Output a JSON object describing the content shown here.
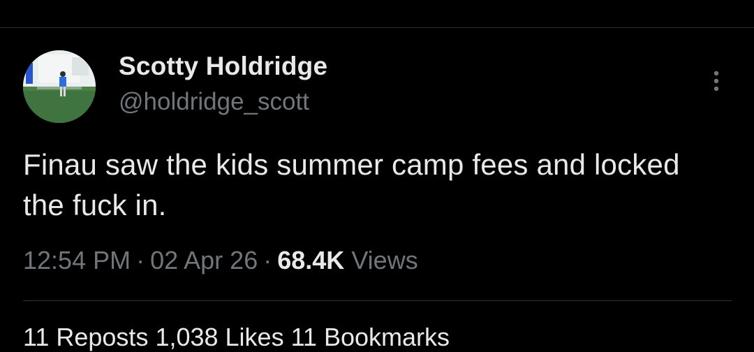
{
  "colors": {
    "background": "#000000",
    "primary_text": "#e7e9ea",
    "secondary_text": "#71767b",
    "divider": "#2f3336"
  },
  "author": {
    "display_name": "Scotty Holdridge",
    "handle": "@holdridge_scott",
    "avatar_icon": "profile-photo-golfer-on-range"
  },
  "more_icon": "more-vertical-icon",
  "tweet": {
    "text": "Finau saw the kids summer camp fees and locked the fuck in."
  },
  "meta": {
    "time": "12:54 PM",
    "separator": "·",
    "date": "02 Apr 26",
    "views_count": "68.4K",
    "views_label": "Views"
  },
  "stats": {
    "partial_text": "11 Reposts  1,038 Likes  11 Bookmarks"
  }
}
